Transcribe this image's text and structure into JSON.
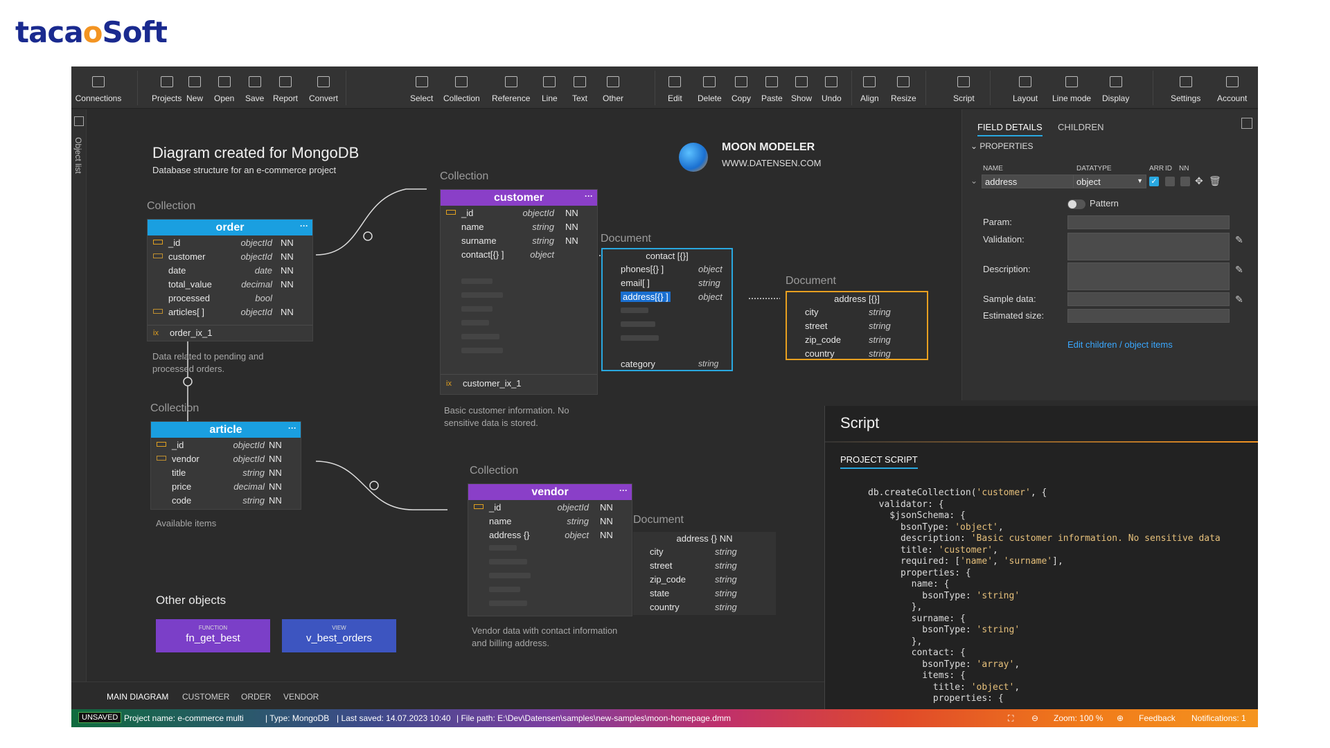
{
  "brand": {
    "logo_pre": "taca",
    "logo_o": "o",
    "logo_post": "Soft"
  },
  "toolbar": {
    "connections": "Connections",
    "projects": "Projects",
    "new": "New",
    "open": "Open",
    "save": "Save",
    "report": "Report",
    "convert": "Convert",
    "select": "Select",
    "collection": "Collection",
    "reference": "Reference",
    "line": "Line",
    "text": "Text",
    "other": "Other",
    "edit": "Edit",
    "delete": "Delete",
    "copy": "Copy",
    "paste": "Paste",
    "show": "Show",
    "undo": "Undo",
    "align": "Align",
    "resize": "Resize",
    "script": "Script",
    "layout": "Layout",
    "linemode": "Line mode",
    "display": "Display",
    "settings": "Settings",
    "account": "Account"
  },
  "sidebar": {
    "label": "Object list"
  },
  "diagram": {
    "title": "Diagram created for MongoDB",
    "subtitle": "Database structure for an e-commerce project",
    "moon_title": "MOON MODELER",
    "moon_url": "WWW.DATENSEN.COM",
    "collection_label": "Collection",
    "document_label": "Document",
    "other_objects": "Other objects"
  },
  "order": {
    "name": "order",
    "index": "order_ix_1",
    "note": "Data related to pending and processed orders.",
    "fields": [
      {
        "name": "_id",
        "type": "objectId",
        "nn": "NN"
      },
      {
        "name": "customer",
        "type": "objectId",
        "nn": "NN"
      },
      {
        "name": "date",
        "type": "date",
        "nn": "NN"
      },
      {
        "name": "total_value",
        "type": "decimal",
        "nn": "NN"
      },
      {
        "name": "processed",
        "type": "bool",
        "nn": ""
      },
      {
        "name": "articles[ ]",
        "type": "objectId",
        "nn": "NN"
      }
    ]
  },
  "customer": {
    "name": "customer",
    "index": "customer_ix_1",
    "note": "Basic customer information. No sensitive data is stored.",
    "fields": [
      {
        "name": "_id",
        "type": "objectId",
        "nn": "NN"
      },
      {
        "name": "name",
        "type": "string",
        "nn": "NN"
      },
      {
        "name": "surname",
        "type": "string",
        "nn": "NN"
      },
      {
        "name": "contact[{} ]",
        "type": "object",
        "nn": ""
      }
    ]
  },
  "contact": {
    "name": "contact [{}]",
    "fields": [
      {
        "name": "phones[{} ]",
        "type": "object"
      },
      {
        "name": "email[ ]",
        "type": "string"
      },
      {
        "name": "address[{} ]",
        "type": "object"
      }
    ],
    "last": {
      "name": "category",
      "type": "string"
    }
  },
  "address": {
    "name": "address [{}]",
    "fields": [
      {
        "name": "city",
        "type": "string"
      },
      {
        "name": "street",
        "type": "string"
      },
      {
        "name": "zip_code",
        "type": "string"
      },
      {
        "name": "country",
        "type": "string"
      }
    ]
  },
  "article": {
    "name": "article",
    "note": "Available items",
    "fields": [
      {
        "name": "_id",
        "type": "objectId",
        "nn": "NN"
      },
      {
        "name": "vendor",
        "type": "objectId",
        "nn": "NN"
      },
      {
        "name": "title",
        "type": "string",
        "nn": "NN"
      },
      {
        "name": "price",
        "type": "decimal",
        "nn": "NN"
      },
      {
        "name": "code",
        "type": "string",
        "nn": "NN"
      }
    ]
  },
  "vendor": {
    "name": "vendor",
    "note": "Vendor data with contact information and billing address.",
    "fields": [
      {
        "name": "_id",
        "type": "objectId",
        "nn": "NN"
      },
      {
        "name": "name",
        "type": "string",
        "nn": "NN"
      },
      {
        "name": "address {}",
        "type": "object",
        "nn": "NN"
      }
    ]
  },
  "vaddress": {
    "name": "address {} NN",
    "fields": [
      {
        "name": "city",
        "type": "string"
      },
      {
        "name": "street",
        "type": "string"
      },
      {
        "name": "zip_code",
        "type": "string"
      },
      {
        "name": "state",
        "type": "string"
      },
      {
        "name": "country",
        "type": "string"
      }
    ]
  },
  "other": {
    "fn_kind": "FUNCTION",
    "fn_name": "fn_get_best",
    "view_kind": "VIEW",
    "view_name": "v_best_orders"
  },
  "panel": {
    "tab1": "FIELD DETAILS",
    "tab2": "CHILDREN",
    "section": "PROPERTIES",
    "col_name": "NAME",
    "col_type": "DATATYPE",
    "col_arr": "ARR",
    "col_id": "ID",
    "col_nn": "NN",
    "name_value": "address",
    "type_value": "object",
    "pattern": "Pattern",
    "param": "Param:",
    "validation": "Validation:",
    "description": "Description:",
    "sample": "Sample data:",
    "estimated": "Estimated size:",
    "edit_link": "Edit children / object items"
  },
  "script": {
    "title": "Script",
    "tab": "PROJECT SCRIPT"
  },
  "tabs": [
    "MAIN DIAGRAM",
    "CUSTOMER",
    "ORDER",
    "VENDOR"
  ],
  "status": {
    "unsaved": "UNSAVED",
    "project": "Project name: e-commerce multi",
    "type": "| Type: MongoDB",
    "saved": "| Last saved: 14.07.2023 10:40",
    "path": "| File path: E:\\Dev\\Datensen\\samples\\new-samples\\moon-homepage.dmm",
    "zoom": "Zoom: 100 %",
    "feedback": "Feedback",
    "notifications": "Notifications: 1"
  },
  "colors": {
    "order_header": "#1a9fe0",
    "customer_header": "#8a3fc8",
    "article_header": "#1a9fe0",
    "vendor_header": "#8a3fc8",
    "contact_border": "#29a8e0",
    "address_border": "#e8a020",
    "function_bg": "#7b3fc8",
    "view_bg": "#3d55c0"
  }
}
